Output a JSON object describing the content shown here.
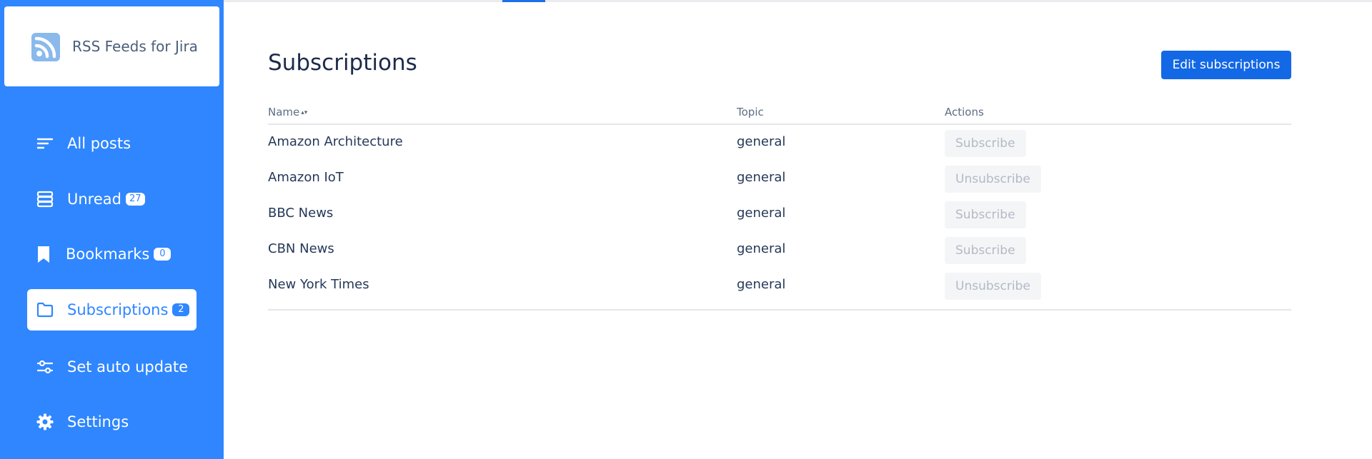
{
  "app": {
    "title": "RSS Feeds for Jira",
    "colors": {
      "sidebar": "#2f86ff",
      "primary_button": "#1368e6",
      "active_tab_indicator": "#1f6feb"
    }
  },
  "sidebar": {
    "items": [
      {
        "label": "All posts",
        "icon": "list-icon",
        "badge": null,
        "active": false
      },
      {
        "label": "Unread",
        "icon": "stack-icon",
        "badge": "27",
        "active": false
      },
      {
        "label": "Bookmarks",
        "icon": "bookmark-icon",
        "badge": "0",
        "active": false
      },
      {
        "label": "Subscriptions",
        "icon": "folder-icon",
        "badge": "2",
        "active": true
      },
      {
        "label": "Set auto update",
        "icon": "sliders-icon",
        "badge": null,
        "active": false
      },
      {
        "label": "Settings",
        "icon": "gear-icon",
        "badge": null,
        "active": false
      }
    ]
  },
  "main": {
    "title": "Subscriptions",
    "edit_button": "Edit subscriptions",
    "table": {
      "headers": {
        "name": "Name",
        "topic": "Topic",
        "actions": "Actions"
      },
      "rows": [
        {
          "name": "Amazon Architecture",
          "topic": "general",
          "action": "Subscribe"
        },
        {
          "name": "Amazon IoT",
          "topic": "general",
          "action": "Unsubscribe"
        },
        {
          "name": "BBC News",
          "topic": "general",
          "action": "Subscribe"
        },
        {
          "name": "CBN News",
          "topic": "general",
          "action": "Subscribe"
        },
        {
          "name": "New York Times",
          "topic": "general",
          "action": "Unsubscribe"
        }
      ]
    }
  }
}
